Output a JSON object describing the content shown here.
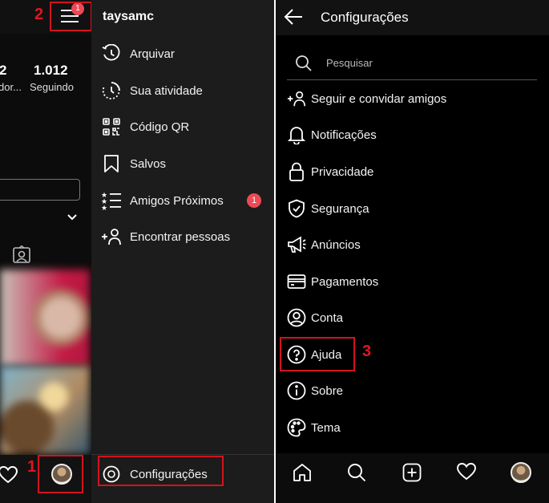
{
  "profile_panel": {
    "stats": [
      {
        "number": "2",
        "label": "dor..."
      },
      {
        "number": "1.012",
        "label": "Seguindo"
      }
    ],
    "menu_badge": "1"
  },
  "side_menu": {
    "username": "taysamc",
    "items": [
      {
        "label": "Arquivar",
        "icon": "archive-icon"
      },
      {
        "label": "Sua atividade",
        "icon": "activity-icon"
      },
      {
        "label": "Código QR",
        "icon": "qr-code-icon"
      },
      {
        "label": "Salvos",
        "icon": "bookmark-icon"
      },
      {
        "label": "Amigos Próximos",
        "icon": "close-friends-icon",
        "badge": "1"
      },
      {
        "label": "Encontrar pessoas",
        "icon": "add-person-icon"
      }
    ],
    "settings_label": "Configurações"
  },
  "settings": {
    "title": "Configurações",
    "search_placeholder": "Pesquisar",
    "items": [
      {
        "label": "Seguir e convidar amigos",
        "icon": "add-person-icon"
      },
      {
        "label": "Notificações",
        "icon": "bell-icon"
      },
      {
        "label": "Privacidade",
        "icon": "lock-icon"
      },
      {
        "label": "Segurança",
        "icon": "shield-icon"
      },
      {
        "label": "Anúncios",
        "icon": "megaphone-icon"
      },
      {
        "label": "Pagamentos",
        "icon": "card-icon"
      },
      {
        "label": "Conta",
        "icon": "user-circle-icon"
      },
      {
        "label": "Ajuda",
        "icon": "help-icon"
      },
      {
        "label": "Sobre",
        "icon": "info-icon"
      },
      {
        "label": "Tema",
        "icon": "palette-icon"
      }
    ]
  },
  "annotations": {
    "step1": "1",
    "step2": "2",
    "step3": "3"
  },
  "colors": {
    "annotation": "#d0141f",
    "badge": "#ed4956"
  }
}
